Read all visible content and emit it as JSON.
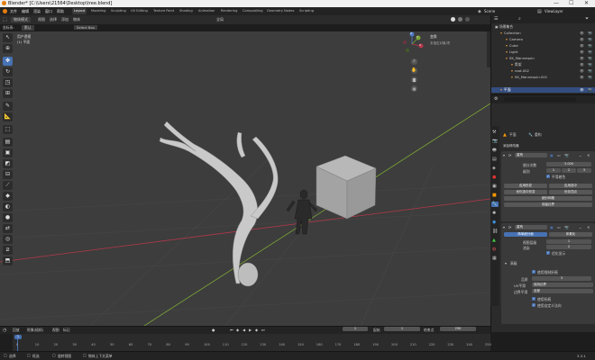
{
  "window": {
    "title": "Blender* [C:\\Users\\21564\\Desktop\\tree.blend]",
    "controls": [
      "—",
      "☐",
      "✕"
    ]
  },
  "menus": [
    "文件",
    "编辑",
    "渲染",
    "窗口",
    "帮助"
  ],
  "workspaces": [
    "Layout",
    "Modeling",
    "Sculpting",
    "UV Editing",
    "Texture Paint",
    "Shading",
    "Animation",
    "Rendering",
    "Compositing",
    "Geometry Nodes",
    "Scripting"
  ],
  "active_workspace": "Layout",
  "scene_name": "Scene",
  "view_layer": "ViewLayer",
  "header": {
    "mode": "物体模式",
    "menus": [
      "视图",
      "选择",
      "添加",
      "物体"
    ],
    "transform": "全局",
    "select_box": "Select Box",
    "coord_label": "坐标系:",
    "global_label": "默认"
  },
  "viewport": {
    "info_line1": "用户透视",
    "info_line2": "(1) 平面",
    "gizmo_x": "X",
    "gizmo_y": "Y",
    "gizmo_z": "Z",
    "panel_title": "变换",
    "panel_text": "未指定对象/项"
  },
  "outliner": {
    "root": "场景集合",
    "items": [
      {
        "label": "Collection",
        "indent": 1,
        "selected": false
      },
      {
        "label": "Camera",
        "indent": 2,
        "selected": false
      },
      {
        "label": "Cube",
        "indent": 2,
        "selected": false
      },
      {
        "label": "Light",
        "indent": 2,
        "selected": false
      },
      {
        "label": "SK_Mannequin",
        "indent": 2,
        "selected": false
      },
      {
        "label": "骨架",
        "indent": 3,
        "selected": false
      },
      {
        "label": "root.002",
        "indent": 3,
        "selected": false
      },
      {
        "label": "SK_Mannequin.001",
        "indent": 3,
        "selected": false
      },
      {
        "label": "平面",
        "indent": 1,
        "selected": true
      }
    ]
  },
  "properties": {
    "object_name": "平面",
    "modifier_label": "重构",
    "add_modifier": "添加修改器",
    "mod1": {
      "name": "重构",
      "subdiv_label": "细分次数",
      "subdiv_value": "3.000",
      "levels_label": "级别",
      "levels_values": [
        "1",
        "2",
        "3"
      ],
      "smooth_label": "平滑着色",
      "buttons": [
        "应用形变",
        "应用选中",
        "优化选中形变",
        "优化顶点",
        "细分网格",
        "保留边界"
      ]
    },
    "mod2": {
      "name": "重构",
      "tabs": [
        "简单细分面",
        "体素化"
      ],
      "fields": [
        {
          "label": "视图层级",
          "value": "1"
        },
        {
          "label": "渲染",
          "value": "2"
        }
      ],
      "check1": "优化显示",
      "section": "高级",
      "check2": "使用限制折痕",
      "fields2": [
        {
          "label": "品质",
          "value": "3"
        },
        {
          "label": "UV平滑",
          "value": "保持边界"
        },
        {
          "label": "边界平滑",
          "value": "全部"
        }
      ],
      "check3": "使用折痕",
      "check4": "使用自定义法向"
    }
  },
  "timeline": {
    "menus": [
      "回放",
      "抠像(插帧)",
      "视图",
      "标记"
    ],
    "current_frame": "1",
    "start_label": "起始",
    "start": "1",
    "end_label": "结束点",
    "end": "250",
    "ticks": [
      "0",
      "10",
      "20",
      "30",
      "40",
      "50",
      "60",
      "70",
      "80",
      "90",
      "100",
      "110",
      "120",
      "130",
      "140",
      "150",
      "160",
      "170",
      "180",
      "190",
      "200",
      "210",
      "220",
      "230",
      "240",
      "250"
    ]
  },
  "status": {
    "item1": "选择",
    "item2": "框选",
    "item3": "旋转视图",
    "item4": "物体上下文菜单",
    "version": "3.3.1"
  },
  "colors": {
    "accent": "#4772b3",
    "cube": "#a9a9a9",
    "tree": "#c9c9c9",
    "axis_x": "#b5384a",
    "axis_y": "#7aa435"
  }
}
